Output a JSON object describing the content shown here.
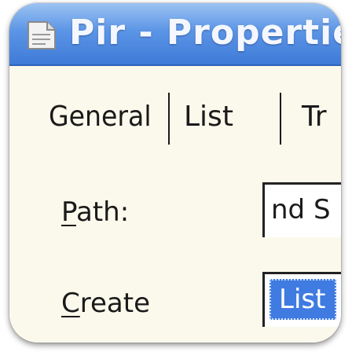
{
  "window": {
    "title": "Pir - Properties",
    "icon": "document-icon"
  },
  "tabs": [
    {
      "label": "General",
      "active": true
    },
    {
      "label": "List",
      "active": false
    },
    {
      "label": "Tr",
      "active": false
    }
  ],
  "form": {
    "path_label": "Path:",
    "path_value": "nd S",
    "create_label": "Create",
    "create_value": "List"
  },
  "colors": {
    "titlebar": "#5b95e6",
    "panel": "#fbf9ec",
    "selection": "#3f7be0"
  }
}
